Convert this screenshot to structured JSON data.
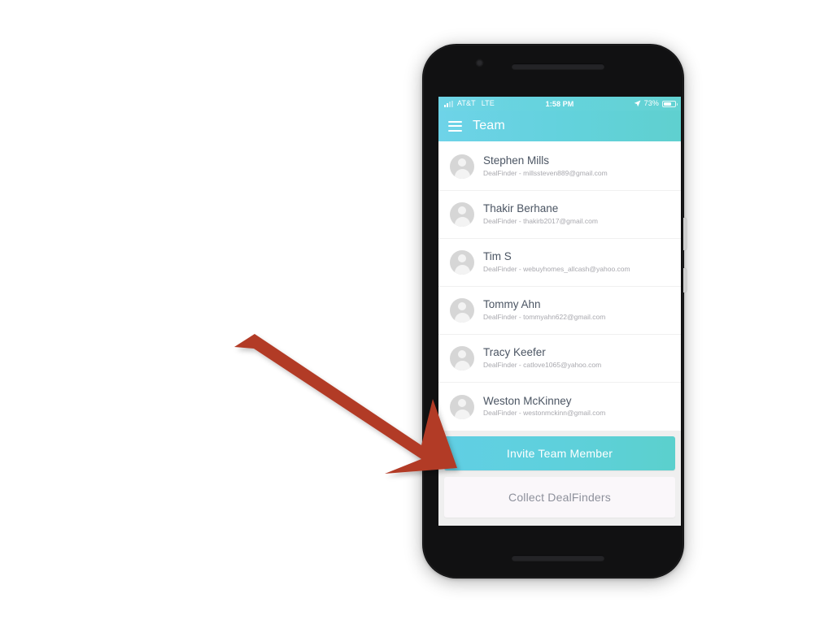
{
  "device": {
    "camera_icon": "front-camera-icon",
    "earpiece_icon": "earpiece-speaker-icon",
    "bottom_speaker_icon": "bottom-speaker-icon",
    "side_buttons": [
      "volume-button",
      "power-button"
    ]
  },
  "status_bar": {
    "signal_icon": "cellular-signal-icon",
    "carrier": "AT&T",
    "network": "LTE",
    "time": "1:58 PM",
    "location_icon": "location-arrow-icon",
    "battery_percent": "73%",
    "battery_level": 73,
    "battery_icon": "battery-icon"
  },
  "app_bar": {
    "menu_icon": "hamburger-menu-icon",
    "title": "Team"
  },
  "members": [
    {
      "avatar_icon": "person-avatar-icon",
      "name": "Stephen Mills",
      "subtitle": "DealFinder - millssteven889@gmail.com"
    },
    {
      "avatar_icon": "person-avatar-icon",
      "name": "Thakir Berhane",
      "subtitle": "DealFinder - thakirb2017@gmail.com"
    },
    {
      "avatar_icon": "person-avatar-icon",
      "name": "Tim S",
      "subtitle": "DealFinder - webuyhomes_allcash@yahoo.com"
    },
    {
      "avatar_icon": "person-avatar-icon",
      "name": "Tommy Ahn",
      "subtitle": "DealFinder - tommyahn622@gmail.com"
    },
    {
      "avatar_icon": "person-avatar-icon",
      "name": "Tracy Keefer",
      "subtitle": "DealFinder - catlove1065@yahoo.com"
    },
    {
      "avatar_icon": "person-avatar-icon",
      "name": "Weston McKinney",
      "subtitle": "DealFinder - westonmckinn@gmail.com"
    }
  ],
  "actions": {
    "invite_label": "Invite Team Member",
    "collect_label": "Collect DealFinders"
  },
  "annotation": {
    "arrow_icon": "pointer-arrow-icon",
    "arrow_color": "#b23a26",
    "points_to": "Invite Team Member"
  },
  "colors": {
    "accent_cyan": "#63d2dd",
    "accent_cyan_light": "#6ed3e8",
    "accent_teal": "#5fd0cf",
    "screen_background": "#efefef",
    "row_background": "#ffffff",
    "name_text": "#4b5563",
    "subtitle_text": "#a8a8ae",
    "collect_button_background": "#faf7fa",
    "collect_button_text": "#8d909b",
    "annotation_red": "#b23a26",
    "phone_body": "#111112"
  }
}
